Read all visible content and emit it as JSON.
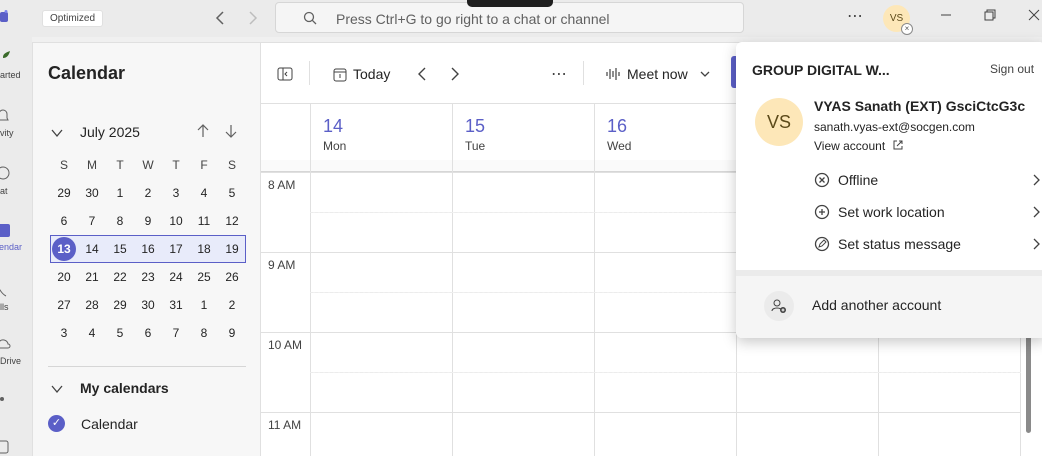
{
  "titlebar": {
    "badge": "Optimized",
    "search_placeholder": "Press Ctrl+G to go right to a chat or channel",
    "avatar_initials": "VS"
  },
  "rail": {
    "items": [
      {
        "label": "arted",
        "icon": "plant-icon"
      },
      {
        "label": "vity",
        "icon": "bell-icon"
      },
      {
        "label": "at",
        "icon": "chat-icon"
      },
      {
        "label": "endar",
        "icon": "calendar-icon"
      },
      {
        "label": "lls",
        "icon": "phone-icon"
      },
      {
        "label": "Drive",
        "icon": "cloud-icon"
      }
    ]
  },
  "sidebar": {
    "title": "Calendar",
    "month": "July 2025",
    "weekdays": [
      "S",
      "M",
      "T",
      "W",
      "T",
      "F",
      "S"
    ],
    "weeks": [
      [
        "29",
        "30",
        "1",
        "2",
        "3",
        "4",
        "5"
      ],
      [
        "6",
        "7",
        "8",
        "9",
        "10",
        "11",
        "12"
      ],
      [
        "13",
        "14",
        "15",
        "16",
        "17",
        "18",
        "19"
      ],
      [
        "20",
        "21",
        "22",
        "23",
        "24",
        "25",
        "26"
      ],
      [
        "27",
        "28",
        "29",
        "30",
        "31",
        "1",
        "2"
      ],
      [
        "3",
        "4",
        "5",
        "6",
        "7",
        "8",
        "9"
      ]
    ],
    "my_calendars": "My calendars",
    "calendar_item": "Calendar"
  },
  "toolbar": {
    "today": "Today",
    "meet_now": "Meet now"
  },
  "grid": {
    "days": [
      {
        "num": "14",
        "name": "Mon"
      },
      {
        "num": "15",
        "name": "Tue"
      },
      {
        "num": "16",
        "name": "Wed"
      }
    ],
    "times": [
      "8 AM",
      "9 AM",
      "10 AM",
      "11 AM"
    ]
  },
  "popup": {
    "org": "GROUP DIGITAL W...",
    "sign_out": "Sign out",
    "avatar_initials": "VS",
    "name": "VYAS Sanath (EXT) GsciCtcG3c",
    "email": "sanath.vyas-ext@socgen.com",
    "view_account": "View account",
    "status": "Offline",
    "work_location": "Set work location",
    "status_message": "Set status message",
    "add_account": "Add another account"
  },
  "colors": {
    "accent": "#5b5fc7",
    "avatar_bg": "#fde7b8"
  }
}
